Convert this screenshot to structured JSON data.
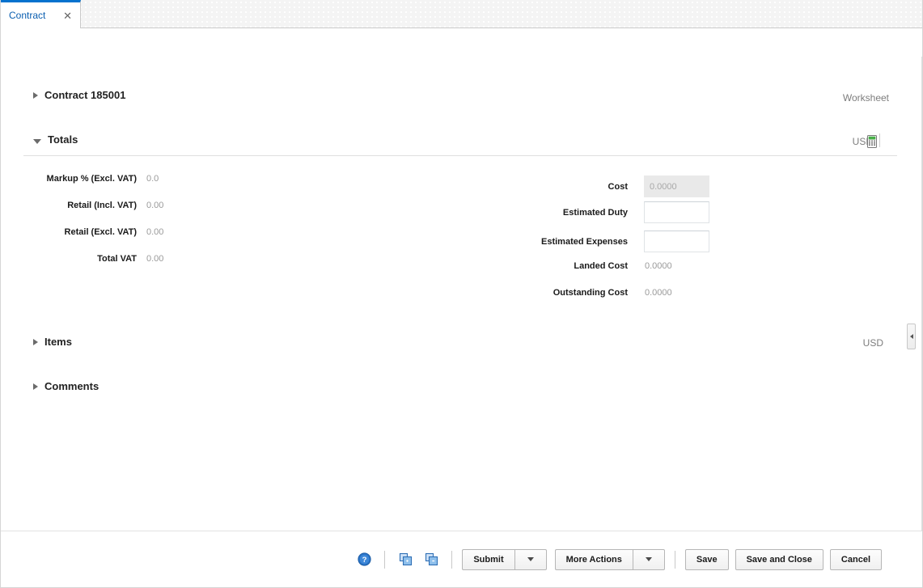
{
  "tab": {
    "label": "Contract",
    "close_icon": "close-icon"
  },
  "header": {
    "title": "Contract 185001",
    "status": "Worksheet"
  },
  "sections": {
    "totals": {
      "title": "Totals",
      "currency": "USD",
      "calculator_icon": "calculator-icon",
      "left_fields": [
        {
          "label": "Markup % (Excl. VAT)",
          "value": "0.0"
        },
        {
          "label": "Retail (Incl. VAT)",
          "value": "0.00"
        },
        {
          "label": "Retail (Excl. VAT)",
          "value": "0.00"
        },
        {
          "label": "Total VAT",
          "value": "0.00"
        }
      ],
      "right_fields": [
        {
          "label": "Cost",
          "value": "0.0000",
          "type": "input-disabled"
        },
        {
          "label": "Estimated Duty",
          "value": "",
          "type": "input"
        },
        {
          "label": "Estimated Expenses",
          "value": "",
          "type": "input"
        },
        {
          "label": "Landed Cost",
          "value": "0.0000",
          "type": "readonly"
        },
        {
          "label": "Outstanding Cost",
          "value": "0.0000",
          "type": "readonly"
        }
      ]
    },
    "items": {
      "title": "Items",
      "currency": "USD"
    },
    "comments": {
      "title": "Comments"
    }
  },
  "footer": {
    "help_icon": "help-icon",
    "expand_all_icon": "expand-all-icon",
    "collapse_all_icon": "collapse-all-icon",
    "submit_label": "Submit",
    "submit_arrow_icon": "chevron-down-icon",
    "more_actions_label": "More Actions",
    "more_actions_arrow_icon": "chevron-down-icon",
    "save_label": "Save",
    "save_and_close_label": "Save and Close",
    "cancel_label": "Cancel"
  },
  "panel": {
    "collapse_handle_icon": "chevron-left-icon"
  },
  "colors": {
    "accent": "#0572ce",
    "tab_text": "#0a5eb0",
    "muted_text": "#7d7d7d",
    "readonly_text": "#9a9a9a"
  }
}
